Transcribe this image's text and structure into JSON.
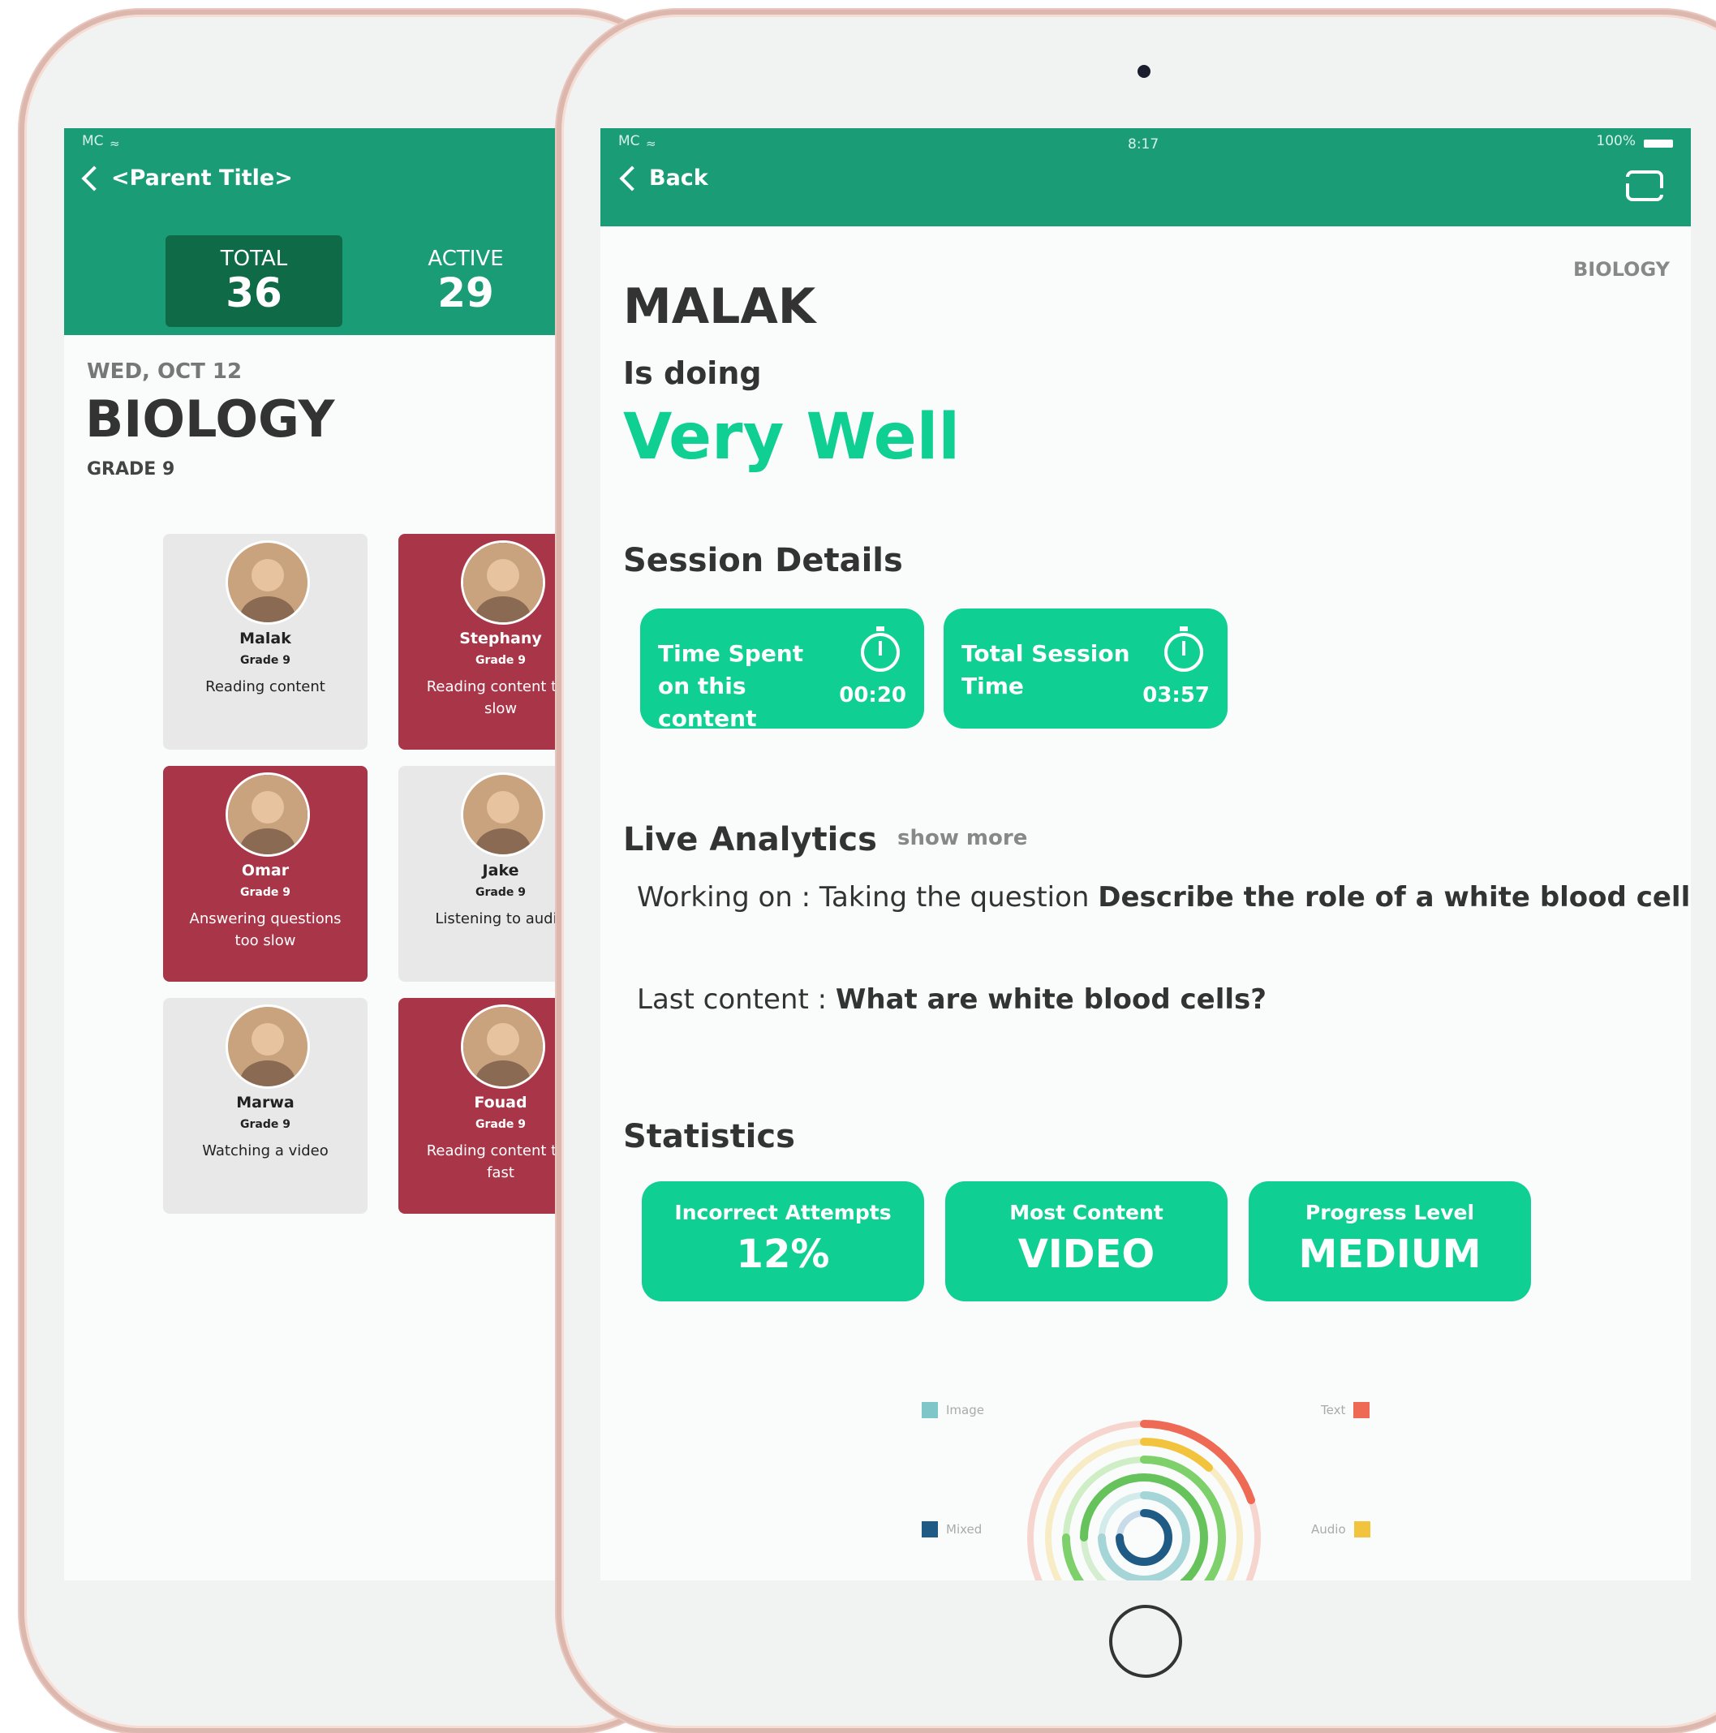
{
  "back_tablet": {
    "status": "MC",
    "nav_title": "<Parent Title>",
    "total_label": "TOTAL",
    "total_value": "36",
    "active_label": "ACTIVE",
    "active_value": "29",
    "date": "WED, OCT 12",
    "subject": "BIOLOGY",
    "grade": "GRADE 9",
    "students": [
      {
        "name": "Malak",
        "grade": "Grade 9",
        "status": "Reading content",
        "color": "gray"
      },
      {
        "name": "Stephany",
        "grade": "Grade 9",
        "status": "Reading content too slow",
        "color": "red"
      },
      {
        "name": "Omar",
        "grade": "Grade 9",
        "status": "Answering questions too slow",
        "color": "red"
      },
      {
        "name": "Jake",
        "grade": "Grade 9",
        "status": "Listening to audio",
        "color": "gray"
      },
      {
        "name": "Marwa",
        "grade": "Grade 9",
        "status": "Watching a video",
        "color": "gray"
      },
      {
        "name": "Fouad",
        "grade": "Grade 9",
        "status": "Reading content too fast",
        "color": "red"
      }
    ]
  },
  "front_tablet": {
    "status": {
      "carrier": "MC",
      "time": "8:17",
      "battery": "100%"
    },
    "back_label": "Back",
    "subject_tag": "BIOLOGY",
    "student_name": "MALAK",
    "is_doing": "Is doing",
    "performance": "Very Well",
    "session_details_title": "Session Details",
    "session": [
      {
        "label": "Time Spent on this content",
        "value": "00:20"
      },
      {
        "label": "Total Session Time",
        "value": "03:57"
      }
    ],
    "live_analytics_title": "Live Analytics",
    "show_more": "show more",
    "working_on_prefix": "Working on : Taking the question ",
    "working_on_question": "Describe the role of a white blood cell",
    "last_content_prefix": "Last content : ",
    "last_content": "What are white blood cells?",
    "statistics_title": "Statistics",
    "stats": [
      {
        "label": "Incorrect Attempts",
        "value": "12%"
      },
      {
        "label": "Most Content",
        "value": "VIDEO"
      },
      {
        "label": "Progress Level",
        "value": "MEDIUM"
      }
    ],
    "legend": [
      {
        "label": "Image",
        "color": "#7fc6c9"
      },
      {
        "label": "Text",
        "color": "#ef6a55"
      },
      {
        "label": "Mixed",
        "color": "#1f5b85"
      },
      {
        "label": "Audio",
        "color": "#f2c33c"
      }
    ]
  },
  "colors": {
    "header_green": "#1a9c76",
    "accent_green": "#0fcf92",
    "alert_red": "#a93548",
    "total_box": "#0f6b47"
  }
}
